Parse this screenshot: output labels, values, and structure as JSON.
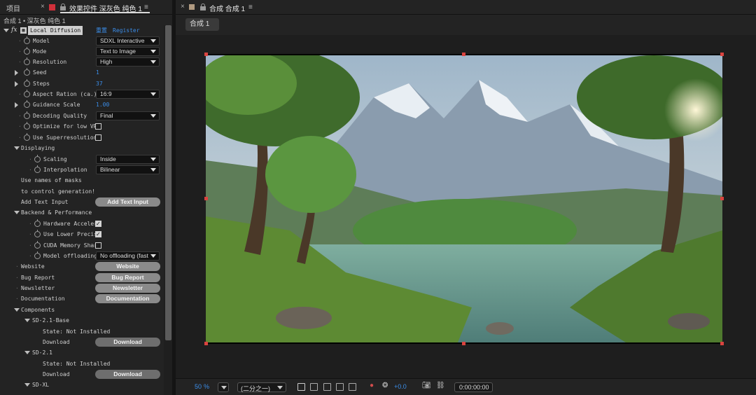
{
  "left_panel": {
    "tab_project": "项目",
    "tab_effects": "效果控件 深灰色 纯色 1",
    "breadcrumb": "合成 1 • 深灰色 纯色 1",
    "effect": {
      "fx_label": "fx",
      "name": "Local Diffusion",
      "reset_label": "重置",
      "register_label": "Register"
    },
    "properties": {
      "model": {
        "label": "Model",
        "value": "SDXL Interactive"
      },
      "mode": {
        "label": "Mode",
        "value": "Text to Image"
      },
      "resolution": {
        "label": "Resolution",
        "value": "High"
      },
      "seed": {
        "label": "Seed",
        "value": "1"
      },
      "steps": {
        "label": "Steps",
        "value": "37"
      },
      "aspect": {
        "label": "Aspect Ration (ca.)",
        "value": "16:9"
      },
      "guidance": {
        "label": "Guidance Scale",
        "value": "1.00"
      },
      "decoding": {
        "label": "Decoding Quality",
        "value": "Final"
      },
      "low_vram": {
        "label": "Optimize for low VRA",
        "checked": false
      },
      "superres": {
        "label": "Use Superresolution",
        "checked": false
      },
      "displaying": {
        "label": "Displaying"
      },
      "scaling": {
        "label": "Scaling",
        "value": "Inside"
      },
      "interpolation": {
        "label": "Interpolation",
        "value": "Bilinear"
      },
      "note_line1": "Use names of masks",
      "note_line2": "to control generation!",
      "text_input": {
        "label": "Add Text Input",
        "button": "Add Text Input"
      },
      "backend": {
        "label": "Backend & Performance"
      },
      "hw_accel": {
        "label": "Hardware Acceler",
        "checked": true
      },
      "lower_prec": {
        "label": "Use Lower Precis",
        "checked": true
      },
      "cuda_mem": {
        "label": "CUDA Memory Shar",
        "checked": false
      },
      "offloading": {
        "label": "Model offloading",
        "value": "No offloading (fast"
      },
      "website": {
        "label": "Website",
        "button": "Website"
      },
      "bug_report": {
        "label": "Bug Report",
        "button": "Bug Report"
      },
      "newsletter": {
        "label": "Newsletter",
        "button": "Newsletter"
      },
      "documentation": {
        "label": "Documentation",
        "button": "Documentation"
      },
      "components": {
        "label": "Components"
      },
      "sd21base": {
        "label": "SD-2.1-Base",
        "state": "State: Not Installed",
        "download_label": "Download",
        "download_button": "Download"
      },
      "sd21": {
        "label": "SD-2.1",
        "state": "State: Not Installed",
        "download_label": "Download",
        "download_button": "Download"
      },
      "sdxl": {
        "label": "SD-XL"
      }
    }
  },
  "right_panel": {
    "tab_comp": "合成 合成 1",
    "comp_button": "合成 1",
    "footer": {
      "zoom": "50",
      "zoom_unit": "%",
      "resolution": "(二分之一)",
      "exposure": "+0.0",
      "timecode": "0:00:00:00"
    }
  },
  "colors": {
    "accent_blue": "#3b8eea",
    "handle_red": "#d9433f",
    "effect_red": "#d0303a"
  }
}
